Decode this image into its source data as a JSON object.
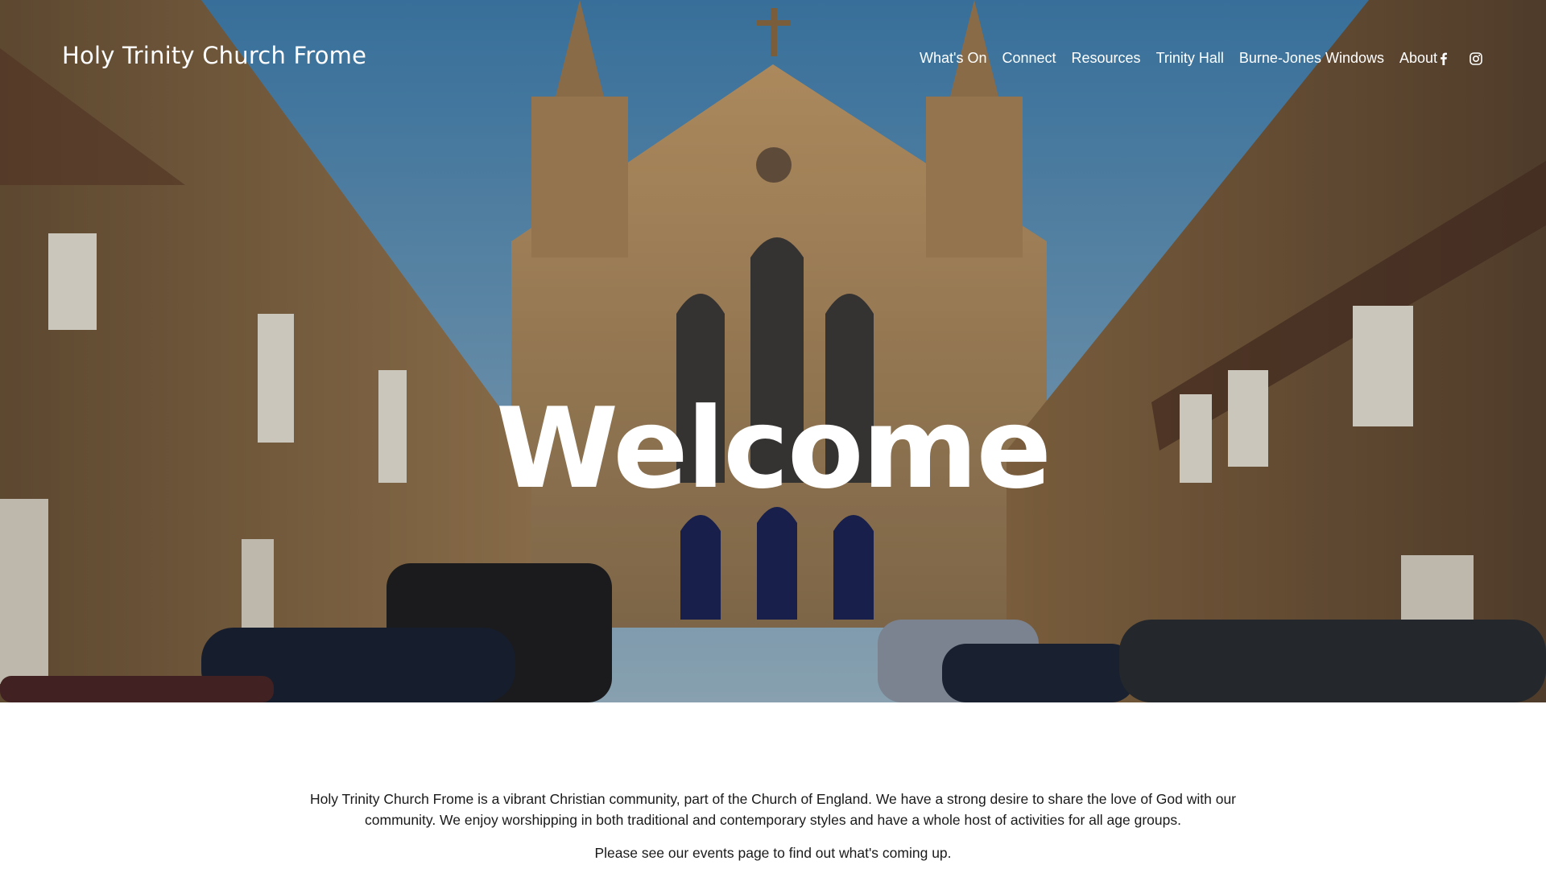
{
  "header": {
    "site_title": "Holy Trinity Church Frome",
    "nav": [
      {
        "label": "What's On"
      },
      {
        "label": "Connect"
      },
      {
        "label": "Resources"
      },
      {
        "label": "Trinity Hall"
      },
      {
        "label": "Burne-Jones Windows"
      },
      {
        "label": "About"
      }
    ],
    "social_icons": [
      "facebook-icon",
      "instagram-icon"
    ]
  },
  "hero": {
    "heading": "Welcome"
  },
  "main": {
    "intro": "Holy Trinity Church Frome is a vibrant Christian community, part of the Church of England. We have a strong desire to share the love of God with our community. We enjoy worshipping in both traditional and contemporary styles and have a whole host of activities for all age groups.",
    "events_note": "Please see our events page to find out what's coming up."
  },
  "colors": {
    "sky": "#4f86ad",
    "stone": "#b08a5a",
    "text": "#1a1a1a",
    "white": "#ffffff"
  }
}
